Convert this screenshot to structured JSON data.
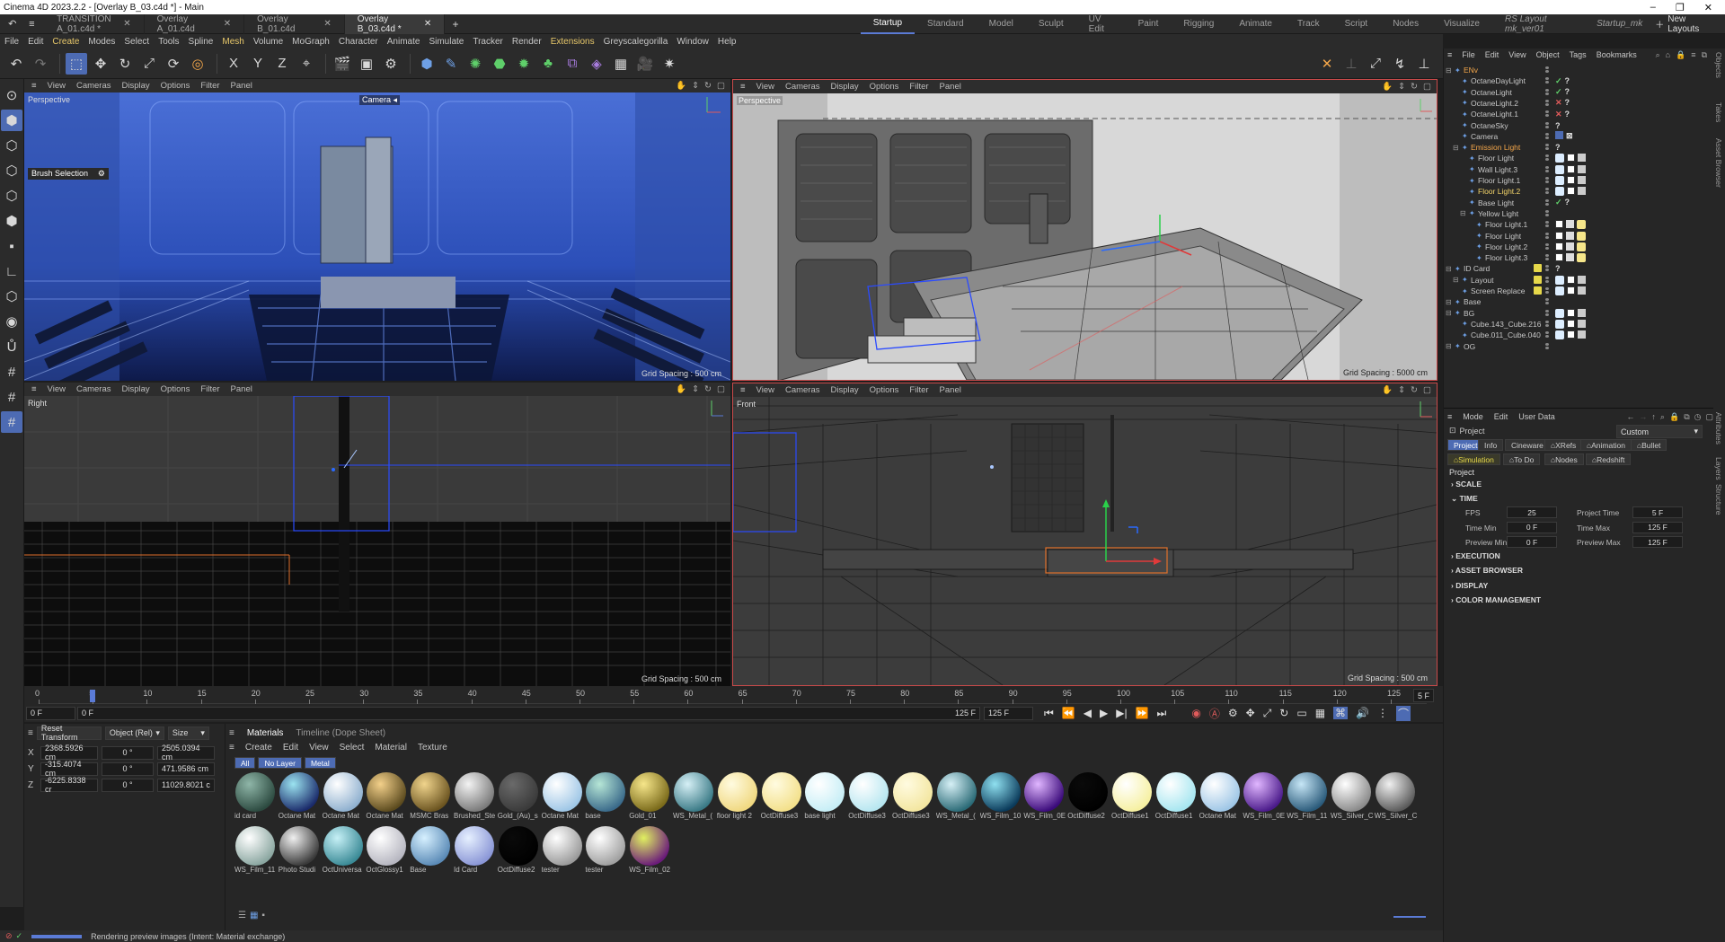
{
  "window": {
    "title": "Cinema 4D 2023.2.2 - [Overlay B_03.c4d *] - Main"
  },
  "doc_tabs": [
    {
      "label": "TRANSITION A_01.c4d *",
      "active": false
    },
    {
      "label": "Overlay A_01.c4d",
      "active": false
    },
    {
      "label": "Overlay B_01.c4d",
      "active": false
    },
    {
      "label": "Overlay B_03.c4d *",
      "active": true
    }
  ],
  "layout_tabs": [
    "Startup",
    "Standard",
    "Model",
    "Sculpt",
    "UV Edit",
    "Paint",
    "Rigging",
    "Animate",
    "Track",
    "Script",
    "Nodes",
    "Visualize",
    "RS Layout mk_ver01",
    "Startup_mk"
  ],
  "new_layouts": "New Layouts",
  "menu": [
    "File",
    "Edit",
    "Create",
    "Modes",
    "Select",
    "Tools",
    "Spline",
    "Mesh",
    "Volume",
    "MoGraph",
    "Character",
    "Animate",
    "Simulate",
    "Tracker",
    "Render",
    "Extensions",
    "Greyscalegorilla",
    "Window",
    "Help"
  ],
  "viewports": [
    {
      "label": "Perspective",
      "camera": "Camera",
      "grid": "Grid Spacing : 500 cm",
      "menu": [
        "View",
        "Cameras",
        "Display",
        "Options",
        "Filter",
        "Panel"
      ],
      "tool_label": "Brush Selection"
    },
    {
      "label": "Perspective",
      "grid": "Grid Spacing : 5000 cm",
      "menu": [
        "View",
        "Cameras",
        "Display",
        "Options",
        "Filter",
        "Panel"
      ]
    },
    {
      "label": "Right",
      "grid": "Grid Spacing : 500 cm",
      "menu": [
        "View",
        "Cameras",
        "Display",
        "Options",
        "Filter",
        "Panel"
      ]
    },
    {
      "label": "Front",
      "grid": "Grid Spacing : 500 cm",
      "menu": [
        "View",
        "Cameras",
        "Display",
        "Options",
        "Filter",
        "Panel"
      ]
    }
  ],
  "timeline": {
    "ticks": [
      "0",
      "5",
      "10",
      "15",
      "20",
      "25",
      "30",
      "35",
      "40",
      "45",
      "50",
      "55",
      "60",
      "65",
      "70",
      "75",
      "80",
      "85",
      "90",
      "95",
      "100",
      "105",
      "110",
      "115",
      "120",
      "125"
    ],
    "current_frame_label": "5 F",
    "start": "0 F",
    "min": "0 F",
    "end_label": "125 F",
    "end": "125 F",
    "playhead_frame": 5,
    "max_frame": 125
  },
  "coords": {
    "reset": "Reset Transform",
    "mode": "Object (Rel)",
    "size": "Size",
    "rows": [
      {
        "axis": "X",
        "pos": "2368.5926 cm",
        "rot": "0 °",
        "size": "2505.0394 cm"
      },
      {
        "axis": "Y",
        "pos": "-315.4074 cm",
        "rot": "0 °",
        "size": "471.9586 cm"
      },
      {
        "axis": "Z",
        "pos": "-6225.8338 cr",
        "rot": "0 °",
        "size": "11029.8021 c"
      }
    ]
  },
  "materials": {
    "tabs": [
      "Materials",
      "Timeline (Dope Sheet)"
    ],
    "menu": [
      "Create",
      "Edit",
      "View",
      "Select",
      "Material",
      "Texture"
    ],
    "filters": [
      "All",
      "No Layer",
      "Metal"
    ],
    "row1": [
      {
        "name": "id card",
        "c1": "#8fb6a8",
        "c2": "#2c4a40"
      },
      {
        "name": "Octane Mat",
        "c1": "#9be3f0",
        "c2": "#1a2a6a"
      },
      {
        "name": "Octane Mat",
        "c1": "#ffffff",
        "c2": "#8fb0cf"
      },
      {
        "name": "Octane Mat",
        "c1": "#f3d08a",
        "c2": "#5b4a1e"
      },
      {
        "name": "MSMC Bras",
        "c1": "#f0d48c",
        "c2": "#6b5420"
      },
      {
        "name": "Brushed_Ste",
        "c1": "#f3f3f3",
        "c2": "#7a7a7a"
      },
      {
        "name": "Gold_(Au)_s",
        "c1": "#6a6a6a",
        "c2": "#3a3a3a"
      },
      {
        "name": "Octane Mat",
        "c1": "#ffffff",
        "c2": "#9ec6e6"
      },
      {
        "name": "base",
        "c1": "#b6e6d6",
        "c2": "#3a6a8a"
      },
      {
        "name": "Gold_01",
        "c1": "#f6e68a",
        "c2": "#7a6a1a"
      },
      {
        "name": "WS_Metal_(",
        "c1": "#d6f0f6",
        "c2": "#3a7a86"
      },
      {
        "name": "floor light 2",
        "c1": "#fffbe0",
        "c2": "#f0d880"
      },
      {
        "name": "OctDiffuse3",
        "c1": "#fffbe0",
        "c2": "#f3e08a"
      },
      {
        "name": "base light",
        "c1": "#ffffff",
        "c2": "#c6eef6"
      },
      {
        "name": "OctDiffuse3",
        "c1": "#ffffff",
        "c2": "#b6e6f0"
      },
      {
        "name": "OctDiffuse3",
        "c1": "#fffbe0",
        "c2": "#f3e6a0"
      },
      {
        "name": "WS_Metal_(",
        "c1": "#d6f0f6",
        "c2": "#2a6a76"
      },
      {
        "name": "WS_Film_10",
        "c1": "#8fe0f0",
        "c2": "#0a3a5a"
      },
      {
        "name": "WS_Film_0E",
        "c1": "#e0b6ff",
        "c2": "#3a0a7a"
      },
      {
        "name": "OctDiffuse2",
        "c1": "#0a0a0a",
        "c2": "#000000"
      },
      {
        "name": "OctDiffuse1",
        "c1": "#ffffff",
        "c2": "#f6f0a0"
      },
      {
        "name": "OctDiffuse1",
        "c1": "#ffffff",
        "c2": "#a6e6f0"
      },
      {
        "name": "Octane Mat",
        "c1": "#ffffff",
        "c2": "#9ec6e6"
      },
      {
        "name": "WS_Film_0E",
        "c1": "#e0b6ff",
        "c2": "#4a1a8a"
      },
      {
        "name": "WS_Film_11",
        "c1": "#c6e6f6",
        "c2": "#2a5a7a"
      },
      {
        "name": "WS_Silver_C",
        "c1": "#ffffff",
        "c2": "#8a8a8a"
      },
      {
        "name": "WS_Silver_C",
        "c1": "#f0f0f0",
        "c2": "#5a5a5a"
      }
    ],
    "row2": [
      {
        "name": "WS_Film_11",
        "c1": "#ffffff",
        "c2": "#8aa6a0"
      },
      {
        "name": "Photo Studi",
        "c1": "#f0f0f0",
        "c2": "#3a3a3a"
      },
      {
        "name": "OctUniversa",
        "c1": "#c6f0f6",
        "c2": "#3a8a96"
      },
      {
        "name": "OctGlossy1",
        "c1": "#ffffff",
        "c2": "#b6b6c0"
      },
      {
        "name": "Base",
        "c1": "#d6f0ff",
        "c2": "#5a8ab6"
      },
      {
        "name": "Id Card",
        "c1": "#e6f0ff",
        "c2": "#8a96d6"
      },
      {
        "name": "OctDiffuse2",
        "c1": "#0a0a0a",
        "c2": "#000000"
      },
      {
        "name": "tester",
        "c1": "#ffffff",
        "c2": "#9a9a9a"
      },
      {
        "name": "tester",
        "c1": "#ffffff",
        "c2": "#a0a0a0"
      },
      {
        "name": "WS_Film_02",
        "c1": "#e0f060",
        "c2": "#6a1a7a"
      }
    ]
  },
  "status": {
    "text": "Rendering preview images (Intent: Material exchange)"
  },
  "objects": {
    "menu": [
      "File",
      "Edit",
      "View",
      "Object",
      "Tags",
      "Bookmarks"
    ],
    "tree": [
      {
        "name": "ENv",
        "indent": 0,
        "color": "#f3a64a",
        "tag": "none"
      },
      {
        "name": "OctaneDayLight",
        "indent": 1,
        "color": "#c8c8c8",
        "tag": "check"
      },
      {
        "name": "OctaneLight",
        "indent": 1,
        "color": "#c8c8c8",
        "tag": "check"
      },
      {
        "name": "OctaneLight.2",
        "indent": 1,
        "color": "#c8c8c8",
        "tag": "cross"
      },
      {
        "name": "OctaneLight.1",
        "indent": 1,
        "color": "#c8c8c8",
        "tag": "cross"
      },
      {
        "name": "OctaneSky",
        "indent": 1,
        "color": "#c8c8c8",
        "tag": "q"
      },
      {
        "name": "Camera",
        "indent": 1,
        "color": "#c8c8c8",
        "tag": "blue"
      },
      {
        "name": "Emission Light",
        "indent": 1,
        "color": "#f3a64a",
        "tag": "q"
      },
      {
        "name": "Floor Light",
        "indent": 2,
        "color": "#c8c8c8",
        "tag": "mat"
      },
      {
        "name": "Wall Light.3",
        "indent": 2,
        "color": "#c8c8c8",
        "tag": "mat"
      },
      {
        "name": "Floor Light.1",
        "indent": 2,
        "color": "#c8c8c8",
        "tag": "mat"
      },
      {
        "name": "Floor Light.2",
        "indent": 2,
        "color": "#f3d46a",
        "tag": "mat"
      },
      {
        "name": "Base Light",
        "indent": 2,
        "color": "#c8c8c8",
        "tag": "check"
      },
      {
        "name": "Yellow Light",
        "indent": 2,
        "color": "#c8c8c8",
        "tag": "none"
      },
      {
        "name": "Floor Light.1",
        "indent": 3,
        "color": "#c8c8c8",
        "tag": "yellow"
      },
      {
        "name": "Floor Light",
        "indent": 3,
        "color": "#c8c8c8",
        "tag": "yellow"
      },
      {
        "name": "Floor Light.2",
        "indent": 3,
        "color": "#c8c8c8",
        "tag": "yellow"
      },
      {
        "name": "Floor Light.3",
        "indent": 3,
        "color": "#c8c8c8",
        "tag": "yellow"
      },
      {
        "name": "ID Card",
        "indent": 0,
        "color": "#c8c8c8",
        "tag": "q"
      },
      {
        "name": "Layout",
        "indent": 1,
        "color": "#c8c8c8",
        "tag": "mat"
      },
      {
        "name": "Screen Replace",
        "indent": 1,
        "color": "#c8c8c8",
        "tag": "mat"
      },
      {
        "name": "Base",
        "indent": 0,
        "color": "#c8c8c8",
        "tag": "none"
      },
      {
        "name": "BG",
        "indent": 0,
        "color": "#c8c8c8",
        "tag": "mat"
      },
      {
        "name": "Cube.143_Cube.216",
        "indent": 1,
        "color": "#c8c8c8",
        "tag": "mat"
      },
      {
        "name": "Cube.011_Cube.040",
        "indent": 1,
        "color": "#c8c8c8",
        "tag": "mat"
      },
      {
        "name": "OG",
        "indent": 0,
        "color": "#c8c8c8",
        "tag": "none"
      }
    ],
    "side_tabs": [
      "Objects",
      "Takes",
      "Asset Browser"
    ]
  },
  "attributes": {
    "menu": [
      "Mode",
      "Edit",
      "User Data"
    ],
    "object": "Project",
    "preset": "Custom",
    "tabs_row1": [
      "Project",
      "Info",
      "Cineware",
      "XRefs",
      "Animation",
      "Bullet"
    ],
    "tabs_row2": [
      "Simulation",
      "To Do",
      "Nodes",
      "Redshift"
    ],
    "section_title": "Project",
    "sections": [
      "SCALE",
      "TIME",
      "EXECUTION",
      "ASSET BROWSER",
      "DISPLAY",
      "COLOR MANAGEMENT"
    ],
    "time": [
      {
        "label": "FPS",
        "value": "25",
        "label2": "Project Time",
        "value2": "5 F"
      },
      {
        "label": "Time Min",
        "value": "0 F",
        "label2": "Time Max",
        "value2": "125 F"
      },
      {
        "label": "Preview Min",
        "value": "0 F",
        "label2": "Preview Max",
        "value2": "125 F"
      }
    ],
    "side_tabs": [
      "Attributes",
      "Layers",
      "Structure"
    ]
  }
}
